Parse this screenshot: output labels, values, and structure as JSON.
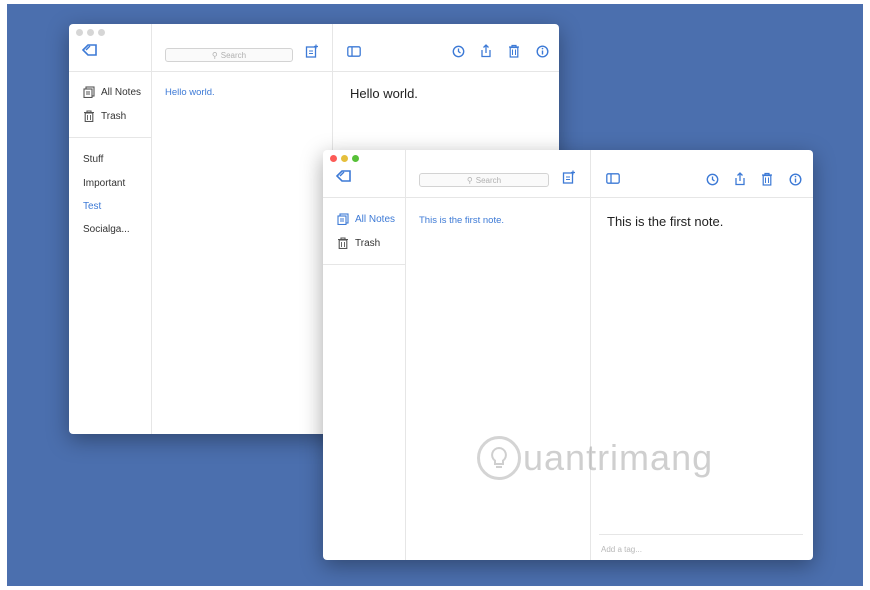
{
  "back_window": {
    "search_placeholder": "Search",
    "nav": [
      {
        "label": "All Notes",
        "icon": "notes-icon"
      },
      {
        "label": "Trash",
        "icon": "trash-icon"
      }
    ],
    "tags": [
      "Stuff",
      "Important",
      "Test",
      "Socialga..."
    ],
    "active_tag": "Test",
    "notes": [
      "Hello world."
    ],
    "editor_text": "Hello world."
  },
  "front_window": {
    "search_placeholder": "Search",
    "nav": [
      {
        "label": "All Notes",
        "icon": "notes-icon",
        "active": true
      },
      {
        "label": "Trash",
        "icon": "trash-icon"
      }
    ],
    "notes": [
      "This is the first note."
    ],
    "editor_text": "This is the first note.",
    "tag_placeholder": "Add a tag..."
  },
  "watermark": {
    "text": "uantrimang"
  },
  "colors": {
    "desktop": "#4b6fae",
    "accent": "#3d7ad6",
    "close": "#fc5b57",
    "minimize": "#e5bf3c",
    "zoom": "#57c038"
  }
}
